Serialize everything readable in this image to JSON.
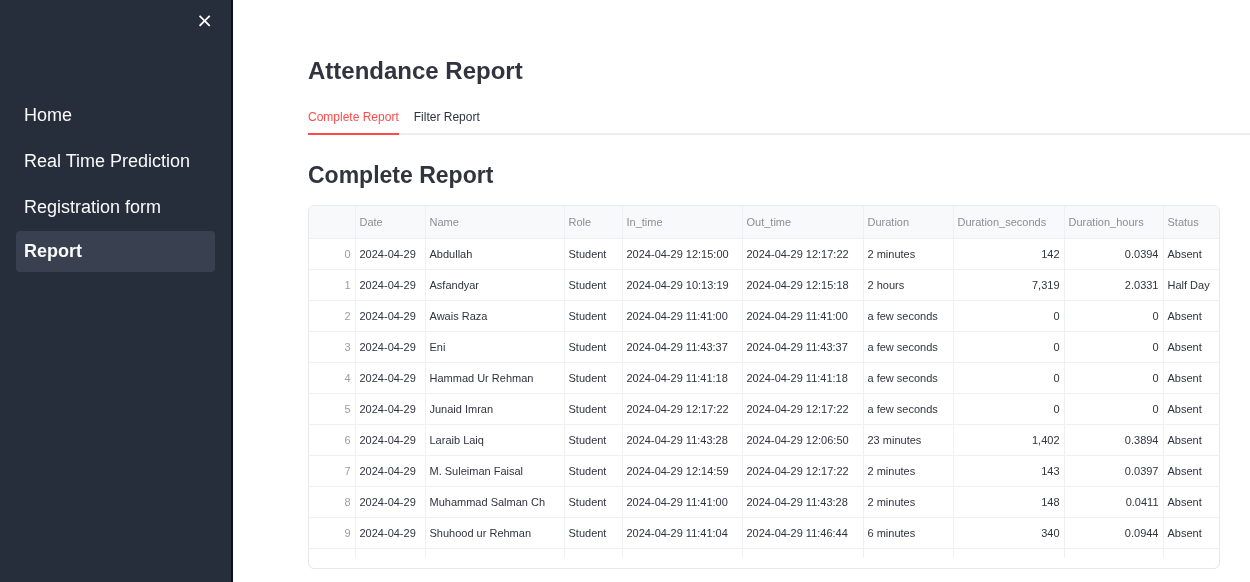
{
  "sidebar": {
    "close_label": "×",
    "items": [
      {
        "label": "Home",
        "selected": false
      },
      {
        "label": "Real Time Prediction",
        "selected": false
      },
      {
        "label": "Registration form",
        "selected": false
      },
      {
        "label": "Report",
        "selected": true
      }
    ]
  },
  "title": "Attendance Report",
  "tabs": [
    {
      "label": "Complete Report",
      "selected": true
    },
    {
      "label": "Filter Report",
      "selected": false
    }
  ],
  "section_heading": "Complete Report",
  "table": {
    "columns": [
      {
        "label": "Date",
        "kind": "text"
      },
      {
        "label": "Name",
        "kind": "text"
      },
      {
        "label": "Role",
        "kind": "text"
      },
      {
        "label": "In_time",
        "kind": "text"
      },
      {
        "label": "Out_time",
        "kind": "text"
      },
      {
        "label": "Duration",
        "kind": "text"
      },
      {
        "label": "Duration_seconds",
        "kind": "number"
      },
      {
        "label": "Duration_hours",
        "kind": "number"
      },
      {
        "label": "Status",
        "kind": "text"
      }
    ],
    "rows": [
      {
        "index": "0",
        "cells": [
          "2024-04-29",
          "Abdullah",
          "Student",
          "2024-04-29 12:15:00",
          "2024-04-29 12:17:22",
          "2 minutes",
          "142",
          "0.0394",
          "Absent"
        ]
      },
      {
        "index": "1",
        "cells": [
          "2024-04-29",
          "Asfandyar",
          "Student",
          "2024-04-29 10:13:19",
          "2024-04-29 12:15:18",
          "2 hours",
          "7,319",
          "2.0331",
          "Half Day"
        ]
      },
      {
        "index": "2",
        "cells": [
          "2024-04-29",
          "Awais Raza",
          "Student",
          "2024-04-29 11:41:00",
          "2024-04-29 11:41:00",
          "a few seconds",
          "0",
          "0",
          "Absent"
        ]
      },
      {
        "index": "3",
        "cells": [
          "2024-04-29",
          "Eni",
          "Student",
          "2024-04-29 11:43:37",
          "2024-04-29 11:43:37",
          "a few seconds",
          "0",
          "0",
          "Absent"
        ]
      },
      {
        "index": "4",
        "cells": [
          "2024-04-29",
          "Hammad Ur Rehman",
          "Student",
          "2024-04-29 11:41:18",
          "2024-04-29 11:41:18",
          "a few seconds",
          "0",
          "0",
          "Absent"
        ]
      },
      {
        "index": "5",
        "cells": [
          "2024-04-29",
          "Junaid Imran",
          "Student",
          "2024-04-29 12:17:22",
          "2024-04-29 12:17:22",
          "a few seconds",
          "0",
          "0",
          "Absent"
        ]
      },
      {
        "index": "6",
        "cells": [
          "2024-04-29",
          "Laraib Laiq",
          "Student",
          "2024-04-29 11:43:28",
          "2024-04-29 12:06:50",
          "23 minutes",
          "1,402",
          "0.3894",
          "Absent"
        ]
      },
      {
        "index": "7",
        "cells": [
          "2024-04-29",
          "M. Suleiman Faisal",
          "Student",
          "2024-04-29 12:14:59",
          "2024-04-29 12:17:22",
          "2 minutes",
          "143",
          "0.0397",
          "Absent"
        ]
      },
      {
        "index": "8",
        "cells": [
          "2024-04-29",
          "Muhammad Salman Ch",
          "Student",
          "2024-04-29 11:41:00",
          "2024-04-29 11:43:28",
          "2 minutes",
          "148",
          "0.0411",
          "Absent"
        ]
      },
      {
        "index": "9",
        "cells": [
          "2024-04-29",
          "Shuhood ur Rehman",
          "Student",
          "2024-04-29 11:41:04",
          "2024-04-29 11:46:44",
          "6 minutes",
          "340",
          "0.0944",
          "Absent"
        ]
      }
    ]
  }
}
